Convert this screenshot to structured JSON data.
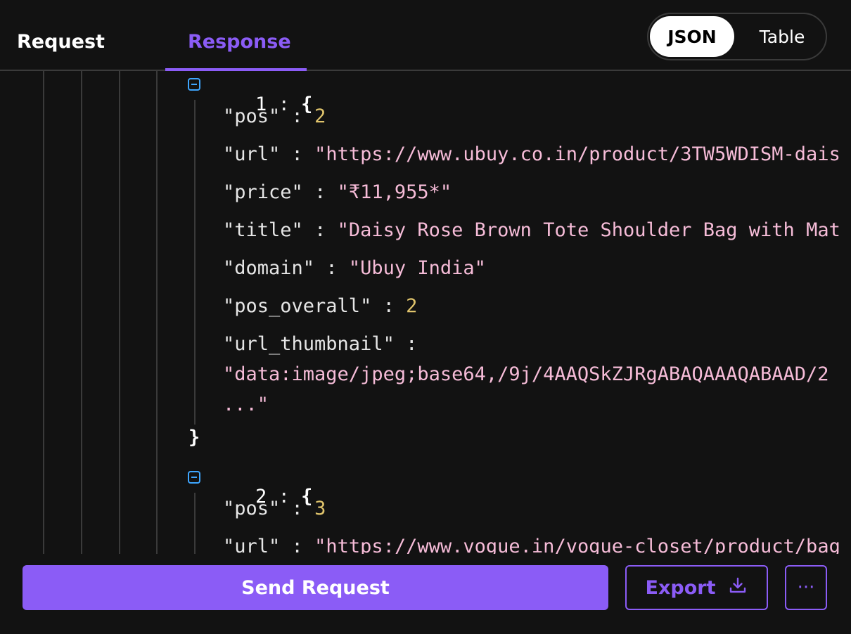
{
  "tabs": {
    "request": "Request",
    "response": "Response"
  },
  "view_toggle": {
    "json": "JSON",
    "table": "Table"
  },
  "response": {
    "item1": {
      "index": "1",
      "pos_key": "\"pos\"",
      "pos_val": "2",
      "url_key": "\"url\"",
      "url_val": "\"https://www.ubuy.co.in/product/3TW5WDISM-dais",
      "price_key": "\"price\"",
      "price_val": "\"₹11,955*\"",
      "title_key": "\"title\"",
      "title_val": "\"Daisy Rose Brown Tote Shoulder Bag with Mat",
      "domain_key": "\"domain\"",
      "domain_val": "\"Ubuy India\"",
      "pos_overall_key": "\"pos_overall\"",
      "pos_overall_val": "2",
      "thumb_key": "\"url_thumbnail\"",
      "thumb_val_line1": "\"data:image/jpeg;base64,/9j/4AAQSkZJRgABAQAAAQABAAD/2",
      "thumb_val_line2": "...\""
    },
    "item2": {
      "index": "2",
      "pos_key": "\"pos\"",
      "pos_val": "3",
      "url_key": "\"url\"",
      "url_val": "\"https://www.vogue.in/vogue-closet/product/bag"
    },
    "colon": ":",
    "open_brace": "{",
    "close_brace": "}"
  },
  "footer": {
    "send_label": "Send Request",
    "export_label": "Export",
    "more_label": "···"
  },
  "colors": {
    "accent": "#8b5cf6",
    "string": "#f6bcd8",
    "number": "#e0c46c",
    "collapse": "#3ea6ff"
  },
  "icons": {
    "export": "download-icon",
    "collapse": "collapse-minus-icon"
  }
}
